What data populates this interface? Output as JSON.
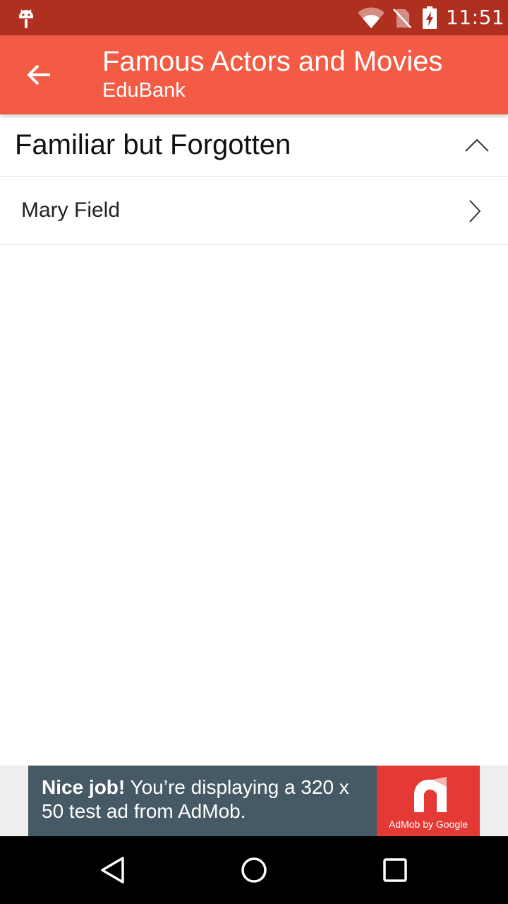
{
  "status_bar": {
    "time": "11:51",
    "icons": [
      "android-debug-icon",
      "wifi-icon",
      "no-sim-icon",
      "battery-charging-icon"
    ]
  },
  "app_bar": {
    "title": "Famous Actors and Movies",
    "subtitle": "EduBank",
    "back_icon": "arrow-back-icon",
    "color": "#f35b44"
  },
  "section": {
    "title": "Familiar but Forgotten",
    "state_icon": "chevron-up-icon",
    "items": [
      {
        "label": "Mary Field",
        "icon": "chevron-right-icon"
      }
    ]
  },
  "ad": {
    "headline": "Nice job!",
    "body": " You’re displaying a 320 x 50 test ad from AdMob.",
    "brand": "AdMob by Google",
    "background": "#455a64",
    "logo_color": "#e53935"
  },
  "nav_bar": {
    "buttons": [
      "back-triangle-icon",
      "home-circle-icon",
      "recents-square-icon"
    ]
  },
  "colors": {
    "status_bar": "#b0301f",
    "accent": "#f35b44"
  }
}
